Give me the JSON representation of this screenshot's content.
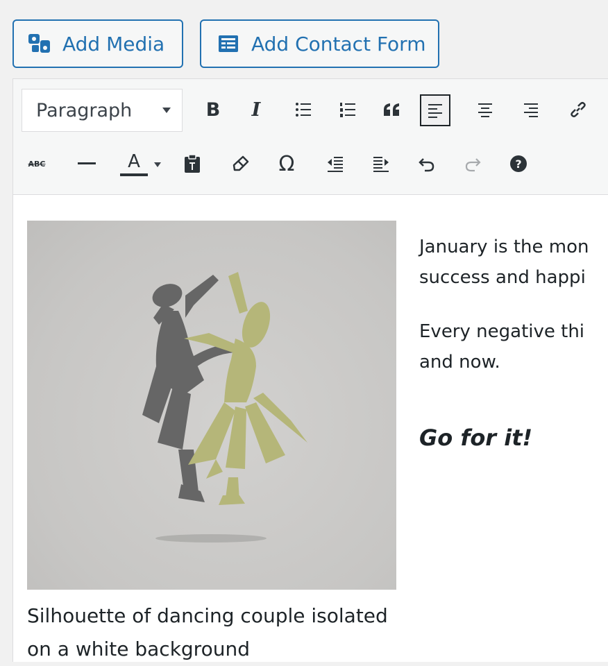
{
  "media_buttons": {
    "add_media": {
      "label": "Add Media",
      "icon": "media-icon"
    },
    "add_contact_form": {
      "label": "Add Contact Form",
      "icon": "form-icon"
    }
  },
  "toolbar": {
    "format_select": {
      "selected": "Paragraph"
    },
    "row1_icons": [
      "bold-icon",
      "italic-icon",
      "bullet-list-icon",
      "numbered-list-icon",
      "blockquote-icon",
      "align-left-icon",
      "align-center-icon",
      "align-right-icon",
      "link-icon"
    ],
    "row2_icons": [
      "strikethrough-icon",
      "horizontal-line-icon",
      "text-color-icon",
      "paste-text-icon",
      "clear-format-icon",
      "special-char-icon",
      "outdent-icon",
      "indent-icon",
      "undo-icon",
      "redo-icon",
      "help-icon"
    ],
    "bold_label": "B",
    "italic_label": "I",
    "text_color_label": "A",
    "strike_label": "ABC",
    "omega_label": "Ω",
    "help_label": "?"
  },
  "content": {
    "image_caption": "Silhouette of dancing couple isolated on a white background",
    "paragraph1_line1": "January is the mon",
    "paragraph1_line2": "success and happi",
    "paragraph2_line1": "Every negative thi",
    "paragraph2_line2": "and now.",
    "heading": "Go for it!"
  },
  "colors": {
    "accent": "#2271b1",
    "dancer_dark": "#666666",
    "dancer_olive": "#b5b679"
  }
}
